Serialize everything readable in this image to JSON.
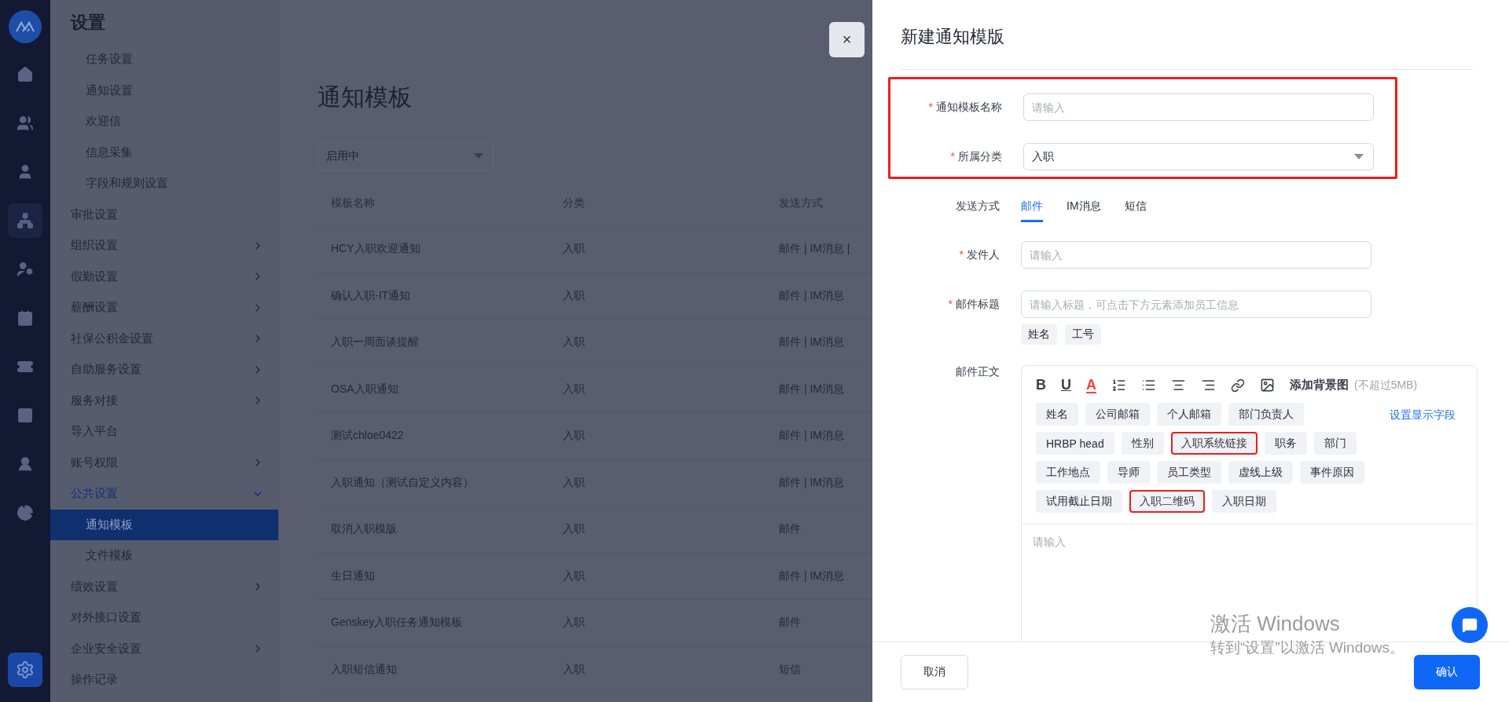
{
  "rail": {
    "items": [
      {
        "selected": false
      },
      {
        "selected": false
      },
      {
        "selected": false
      },
      {
        "selected": true
      },
      {
        "selected": false
      },
      {
        "selected": false
      },
      {
        "selected": false
      },
      {
        "selected": false
      },
      {
        "selected": false
      },
      {
        "selected": false
      }
    ]
  },
  "sidebar": {
    "title": "设置",
    "orphan_items": [
      {
        "label": "任务设置",
        "selected": false
      },
      {
        "label": "通知设置",
        "selected": false
      },
      {
        "label": "欢迎信",
        "selected": false
      },
      {
        "label": "信息采集",
        "selected": false
      },
      {
        "label": "字段和规则设置",
        "selected": false
      }
    ],
    "items": [
      {
        "label": "审批设置",
        "selected": false
      },
      {
        "label": "组织设置",
        "selected": false,
        "expanded": false
      },
      {
        "label": "假勤设置",
        "selected": false,
        "expanded": false
      },
      {
        "label": "薪酬设置",
        "selected": false,
        "expanded": false
      },
      {
        "label": "社保公积金设置",
        "selected": false,
        "expanded": false
      },
      {
        "label": "自助服务设置",
        "selected": false,
        "expanded": false
      },
      {
        "label": "服务对接",
        "selected": false,
        "expanded": false
      },
      {
        "label": "导入平台",
        "selected": false
      },
      {
        "label": "账号权限",
        "selected": false,
        "expanded": false
      },
      {
        "label": "公共设置",
        "selected": false,
        "expanded": true,
        "children": [
          {
            "label": "通知模板",
            "selected": true
          },
          {
            "label": "文件模板",
            "selected": false
          }
        ]
      },
      {
        "label": "绩效设置",
        "selected": false,
        "expanded": false
      },
      {
        "label": "对外接口设置",
        "selected": false
      },
      {
        "label": "企业安全设置",
        "selected": false,
        "expanded": false
      },
      {
        "label": "操作记录",
        "selected": false
      }
    ]
  },
  "page": {
    "title": "通知模板",
    "status_filter": {
      "value": "启用中"
    },
    "table": {
      "columns": [
        "模板名称",
        "分类",
        "发送方式"
      ],
      "rows": [
        [
          "HCY入职欢迎通知",
          "入职",
          "邮件 | IM消息 |"
        ],
        [
          "确认入职-IT通知",
          "入职",
          "邮件 | IM消息"
        ],
        [
          "入职一周面谈提醒",
          "入职",
          "邮件 | IM消息"
        ],
        [
          "OSA入职通知",
          "入职",
          "邮件 | IM消息"
        ],
        [
          "测试chloe0422",
          "入职",
          "邮件 | IM消息"
        ],
        [
          "入职通知（测试自定义内容）",
          "入职",
          "邮件 | IM消息"
        ],
        [
          "取消入职模版",
          "入职",
          "邮件"
        ],
        [
          "生日通知",
          "入职",
          "邮件 | IM消息"
        ],
        [
          "Genskey入职任务通知模板",
          "入职",
          "邮件"
        ],
        [
          "入职短信通知",
          "入职",
          "短信"
        ]
      ]
    }
  },
  "drawer": {
    "close": "×",
    "title": "新建通知模版",
    "required_mark": "*",
    "top_fields": {
      "highlighted": true,
      "name": {
        "label": "通知模板名称",
        "required": true,
        "placeholder": "请输入"
      },
      "category": {
        "label": "所属分类",
        "required": true,
        "value": "入职"
      }
    },
    "send_method": {
      "label": "发送方式",
      "tabs": [
        {
          "label": "邮件",
          "selected": true
        },
        {
          "label": "IM消息",
          "selected": false
        },
        {
          "label": "短信",
          "selected": false
        }
      ]
    },
    "sender": {
      "label": "发件人",
      "required": true,
      "placeholder": "请输入"
    },
    "subject": {
      "label": "邮件标题",
      "required": true,
      "placeholder": "请输入标题，可点击下方元素添加员工信息",
      "tags": [
        "姓名",
        "工号"
      ]
    },
    "body": {
      "label": "邮件正文",
      "toolbar": {
        "bold": "B",
        "underline": "U",
        "text_color": "A",
        "background": "添加背景图",
        "background_hint": "(不超过5MB)"
      },
      "field_link": "设置显示字段",
      "fields": [
        {
          "label": "姓名",
          "highlighted": false
        },
        {
          "label": "公司邮箱",
          "highlighted": false
        },
        {
          "label": "个人邮箱",
          "highlighted": false
        },
        {
          "label": "部门负责人",
          "highlighted": false
        },
        {
          "label": "HRBP head",
          "highlighted": false
        },
        {
          "label": "性别",
          "highlighted": false
        },
        {
          "label": "入职系统链接",
          "highlighted": true
        },
        {
          "label": "职务",
          "highlighted": false
        },
        {
          "label": "部门",
          "highlighted": false
        },
        {
          "label": "工作地点",
          "highlighted": false
        },
        {
          "label": "导师",
          "highlighted": false
        },
        {
          "label": "员工类型",
          "highlighted": false
        },
        {
          "label": "虚线上级",
          "highlighted": false
        },
        {
          "label": "事件原因",
          "highlighted": false
        },
        {
          "label": "试用截止日期",
          "highlighted": false
        },
        {
          "label": "入职二维码",
          "highlighted": true
        },
        {
          "label": "入职日期",
          "highlighted": false
        }
      ],
      "placeholder": "请输入"
    },
    "cancel": "取消",
    "confirm": "确认"
  },
  "os_notice": {
    "title": "激活 Windows",
    "text": "转到“设置”以激活 Windows。"
  }
}
